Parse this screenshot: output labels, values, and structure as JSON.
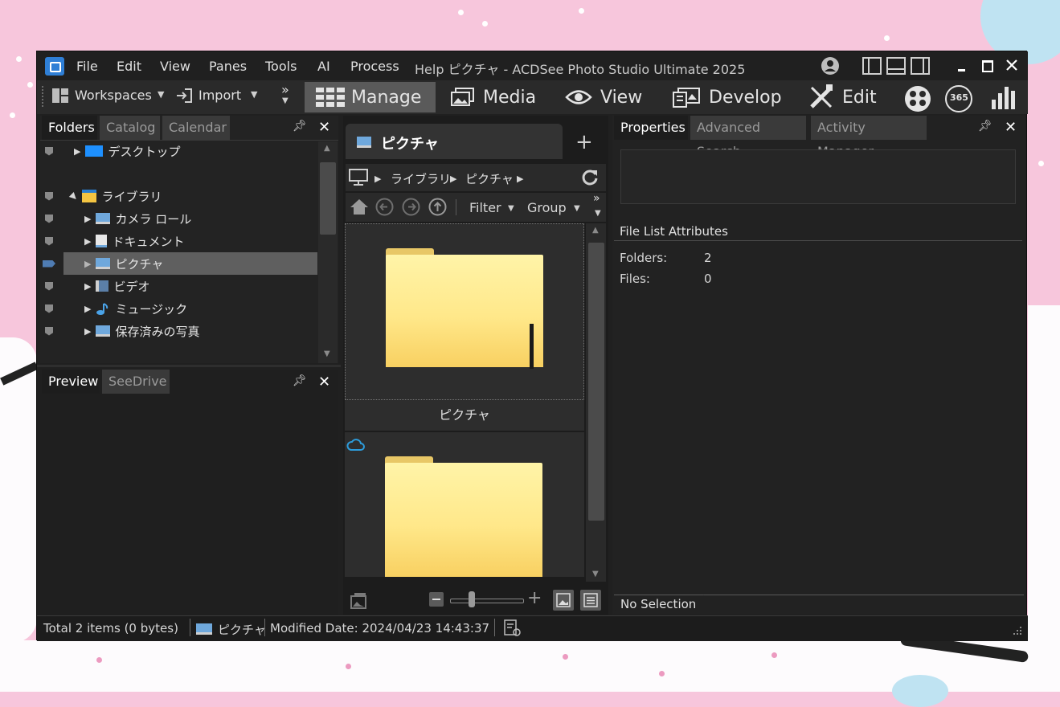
{
  "colors": {
    "accent": "#2f7fd6",
    "window_bg": "#202020",
    "panel_bg": "#2b2b2b",
    "selection": "#5f5f5f",
    "folder": "#ffe88a"
  },
  "title_bar": {
    "window_title": "Help ピクチャ - ACDSee Photo Studio Ultimate 2025",
    "menu": [
      "File",
      "Edit",
      "View",
      "Panes",
      "Tools",
      "AI",
      "Process"
    ],
    "icons": [
      "account-icon",
      "layout-left-icon",
      "layout-bottom-icon",
      "layout-right-icon",
      "minimize-icon",
      "maximize-icon",
      "close-icon"
    ]
  },
  "toolbar": {
    "workspaces": "Workspaces",
    "import": "Import",
    "overflow": "»",
    "modes": [
      "Manage",
      "Media",
      "View",
      "Develop",
      "Edit"
    ],
    "extra_icons": [
      "people-icon",
      "365-icon",
      "dashboard-icon"
    ],
    "badge_365": "365"
  },
  "folders_pane": {
    "tabs": [
      "Folders",
      "Catalog",
      "Calendar"
    ],
    "active_tab": "Folders",
    "items": [
      {
        "label": "デスクトップ",
        "icon": "desktop-icon"
      },
      {
        "label": "ライブラリ",
        "icon": "library-icon",
        "expanded": true
      },
      {
        "label": "カメラ ロール",
        "icon": "camera-roll-icon"
      },
      {
        "label": "ドキュメント",
        "icon": "documents-icon"
      },
      {
        "label": "ピクチャ",
        "icon": "pictures-icon",
        "selected": true
      },
      {
        "label": "ビデオ",
        "icon": "video-icon"
      },
      {
        "label": "ミュージック",
        "icon": "music-icon"
      },
      {
        "label": "保存済みの写真",
        "icon": "saved-pictures-icon"
      }
    ]
  },
  "preview_pane": {
    "tabs": [
      "Preview",
      "SeeDrive"
    ],
    "active_tab": "Preview"
  },
  "file_list": {
    "tab_title": "ピクチャ",
    "add_tab": "+",
    "breadcrumb": [
      "ライブラリ",
      "ピクチャ"
    ],
    "filter": "Filter",
    "group": "Group",
    "items": [
      {
        "label": "ピクチャ",
        "selected": true
      },
      {
        "label": "",
        "cloud": true
      }
    ]
  },
  "properties_pane": {
    "tabs": [
      "Properties",
      "Advanced Search",
      "Activity Manager"
    ],
    "active_tab": "Properties",
    "section_title": "File List Attributes",
    "attributes": [
      {
        "label": "Folders:",
        "value": "2"
      },
      {
        "label": "Files:",
        "value": "0"
      }
    ],
    "footer_tab": "No Selection"
  },
  "status_bar": {
    "total": "Total 2 items  (0 bytes)",
    "folder": "ピクチャ",
    "modified": "Modified Date: 2024/04/23 14:43:37"
  }
}
